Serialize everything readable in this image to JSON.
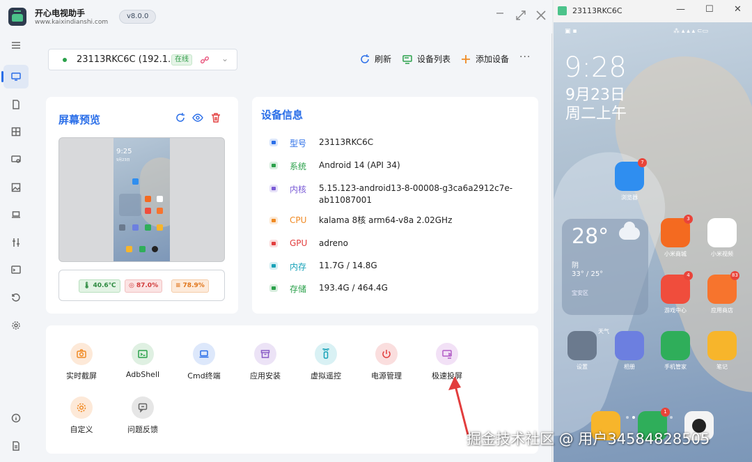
{
  "app": {
    "name": "开心电视助手",
    "url": "www.kaixindianshi.com",
    "version": "v8.0.0"
  },
  "device_select": {
    "label": "23113RKC6C (192.1...",
    "status": "在线"
  },
  "toolbar": {
    "refresh": "刷新",
    "device_list": "设备列表",
    "add_device": "添加设备",
    "more": "···"
  },
  "preview": {
    "title": "屏幕预览",
    "mini_time": "9:25",
    "mini_date": "9月23日",
    "stats": {
      "temp": "40.6℃",
      "cpu": "87.0%",
      "mem": "78.9%"
    }
  },
  "info": {
    "title": "设备信息",
    "rows": [
      {
        "key": "型号",
        "value": "23113RKC6C",
        "color": "#2a6ee8"
      },
      {
        "key": "系统",
        "value": "Android 14 (API 34)",
        "color": "#2ba14b"
      },
      {
        "key": "内核",
        "value": "5.15.123-android13-8-00008-g3ca6a2912c7e-ab11087001",
        "color": "#7b5cd6"
      },
      {
        "key": "CPU",
        "value": "kalama 8核 arm64-v8a 2.02GHz",
        "color": "#f08a24"
      },
      {
        "key": "GPU",
        "value": "adreno",
        "color": "#e23d3d"
      },
      {
        "key": "内存",
        "value": "11.7G / 14.8G",
        "color": "#17a2b8"
      },
      {
        "key": "存储",
        "value": "193.4G / 464.4G",
        "color": "#2ba14b"
      }
    ]
  },
  "functions": [
    {
      "label": "实时截屏",
      "icon": "camera-icon",
      "color": "#f08a24",
      "bg": "#fde9d8"
    },
    {
      "label": "AdbShell",
      "icon": "terminal-icon",
      "color": "#2ba14b",
      "bg": "#dff0e2"
    },
    {
      "label": "Cmd终端",
      "icon": "laptop-icon",
      "color": "#2a6ee8",
      "bg": "#dde8fb"
    },
    {
      "label": "应用安装",
      "icon": "box-icon",
      "color": "#8a5cc6",
      "bg": "#ece3f6"
    },
    {
      "label": "虚拟遥控",
      "icon": "remote-icon",
      "color": "#17a2b8",
      "bg": "#d9f1f4"
    },
    {
      "label": "电源管理",
      "icon": "power-icon",
      "color": "#e23d3d",
      "bg": "#fadede"
    },
    {
      "label": "极速投屏",
      "icon": "cast-icon",
      "color": "#b25cc6",
      "bg": "#f2e1f6"
    },
    {
      "label": "自定义",
      "icon": "gear-icon",
      "color": "#f08a24",
      "bg": "#fde9d8"
    },
    {
      "label": "问题反馈",
      "icon": "feedback-icon",
      "color": "#666666",
      "bg": "#e6e6e6"
    }
  ],
  "watermark": "掘金技术社区 @ 用户34584828505",
  "mirror": {
    "title": "23113RKC6C",
    "time": "9:28",
    "date": "9月23日",
    "day": "周二上午",
    "weather": {
      "temp": "28°",
      "cond": "阴",
      "range": "33° / 25°",
      "loc": "宝安区",
      "name": "天气"
    },
    "apps": [
      {
        "label": "浏览器",
        "badge": "7",
        "color": "#2f8ef0"
      },
      {
        "label": "小米商城",
        "badge": "3",
        "color": "#f46a20"
      },
      {
        "label": "小米视频",
        "badge": "",
        "color": "#ffffff"
      },
      {
        "label": "游戏中心",
        "badge": "4",
        "color": "#f04d3c"
      },
      {
        "label": "应用商店",
        "badge": "83",
        "color": "#f7742d"
      },
      {
        "label": "设置",
        "badge": "",
        "color": "#6b7a8e"
      },
      {
        "label": "相册",
        "badge": "",
        "color": "#6c7fe0"
      },
      {
        "label": "手机管家",
        "badge": "",
        "color": "#2fae5a"
      },
      {
        "label": "笔记",
        "badge": "",
        "color": "#f7b52b"
      }
    ],
    "dock_badge": "1"
  }
}
